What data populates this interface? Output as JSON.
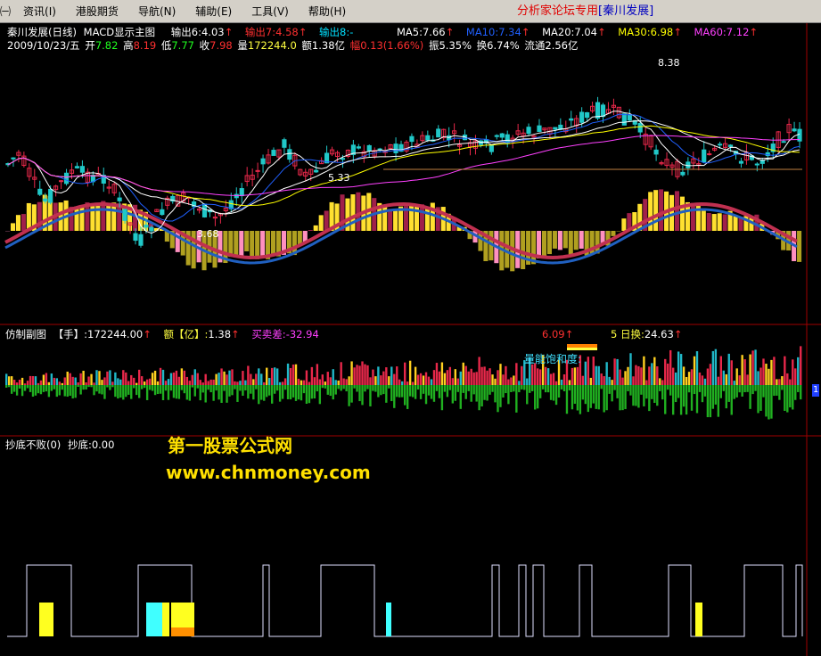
{
  "menu": {
    "items": [
      {
        "key": "partial",
        "label": "㈠"
      },
      {
        "key": "info",
        "label": "资讯(I)"
      },
      {
        "key": "hk",
        "label": "港股期货"
      },
      {
        "key": "nav",
        "label": "导航(N)"
      },
      {
        "key": "assist",
        "label": "辅助(E)"
      },
      {
        "key": "tools",
        "label": "工具(V)"
      },
      {
        "key": "help",
        "label": "帮助(H)"
      }
    ],
    "forum_title": "分析家论坛专用",
    "stock_tag": "[秦川发展]"
  },
  "main_panel": {
    "title": "秦川发展(日线)",
    "indicator": "MACD显示主图",
    "outputs": [
      {
        "label": "输出6:",
        "value": "4.03",
        "color": "#ffffff"
      },
      {
        "label": "输出7:",
        "value": "4.58",
        "color": "#ff3030"
      },
      {
        "label": "输出8:",
        "value": "-",
        "color": "#00e0ff"
      }
    ],
    "ma": [
      {
        "label": "MA5:",
        "value": "7.66",
        "color": "#ffffff"
      },
      {
        "label": "MA10:",
        "value": "7.34",
        "color": "#2060ff"
      },
      {
        "label": "MA20:",
        "value": "7.04",
        "color": "#ffffff"
      },
      {
        "label": "MA30:",
        "value": "6.98",
        "color": "#ffff00"
      },
      {
        "label": "MA60:",
        "value": "7.12",
        "color": "#ff40ff"
      }
    ],
    "ohlc": {
      "date": "2009/10/23/五",
      "open_label": "开",
      "open": "7.82",
      "high_label": "高",
      "high": "8.19",
      "low_label": "低",
      "low": "7.77",
      "close_label": "收",
      "close": "7.98",
      "vol_label": "量",
      "vol": "172244.0",
      "amt_label": "额",
      "amt": "1.38亿",
      "chg_label": "幅",
      "chg": "0.13(1.66%)",
      "amp_label": "振",
      "amp": "5.35%",
      "turn_label": "换",
      "turn": "6.74%",
      "float_label": "流通",
      "float": "2.56亿"
    },
    "annotations": {
      "high": "8.38",
      "low": "3.68",
      "mid": "5.33"
    }
  },
  "volume_panel": {
    "title": "仿制副图",
    "hand": {
      "label": "【手】:",
      "value": "172244.00"
    },
    "amount": {
      "label": "额【亿】:",
      "value": "1.38"
    },
    "spread": {
      "label": "买卖差:",
      "value": "-32.94"
    },
    "partial": {
      "value": "6.09"
    },
    "turnover5": {
      "label": "5 日换:",
      "value": "24.63"
    },
    "saturation": "量能饱和度:",
    "right_tick": "1"
  },
  "bottom_panel": {
    "title": "抄底不败(0)",
    "bottom": {
      "label": "抄底:",
      "value": "0.00"
    }
  },
  "watermark": {
    "line1": "第一股票公式网",
    "line2": "www.chnmoney.com"
  },
  "colors": {
    "up": "#e8284a",
    "down": "#20c8c8",
    "macd_pos": "#ffe030",
    "macd_pos_dark": "#a0204a",
    "macd_neg": "#b0a020",
    "macd_neg2": "#ff90c0",
    "vol_up": "#e8284a",
    "vol_cyan": "#20b8c8",
    "vol_yellow": "#ffd020",
    "vol_neg": "#20b020",
    "panel_border": "#a00000",
    "step_line": "#e0e0ff",
    "bottom_yellow": "#ffff20",
    "bottom_cyan": "#40ffff"
  }
}
